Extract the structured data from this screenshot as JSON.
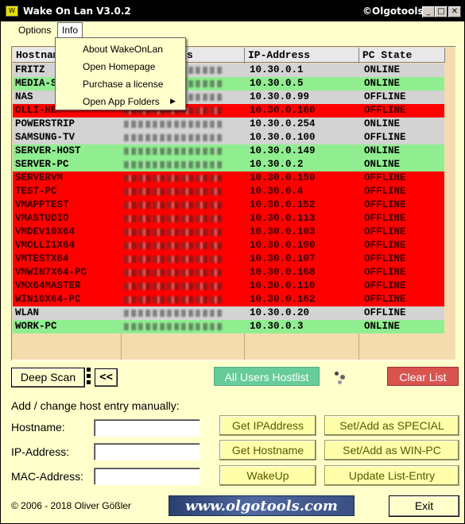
{
  "titlebar": {
    "title": "Wake On Lan V3.0.2",
    "brand": "©Olgotools",
    "minimize": "_",
    "maximize": "□",
    "close": "✕",
    "icon_label": "W"
  },
  "menu": {
    "options": "Options",
    "info": "Info",
    "info_items": [
      "About WakeOnLan",
      "Open Homepage",
      "Purchase a license",
      "Open App Folders"
    ]
  },
  "table": {
    "headers": [
      "Hostname",
      "MAC-Address",
      "IP-Address",
      "PC State"
    ],
    "rows": [
      {
        "host": "FRITZ",
        "ip": "10.30.0.1",
        "state": "ONLINE",
        "color": "gray"
      },
      {
        "host": "MEDIA-SERVER",
        "ip": "10.30.0.5",
        "state": "ONLINE",
        "color": "green"
      },
      {
        "host": "NAS",
        "ip": "10.30.0.99",
        "state": "OFFLINE",
        "color": "gray"
      },
      {
        "host": "OLLI-HB",
        "ip": "10.30.0.160",
        "state": "OFFLINE",
        "color": "red"
      },
      {
        "host": "POWERSTRIP",
        "ip": "10.30.0.254",
        "state": "ONLINE",
        "color": "gray"
      },
      {
        "host": "SAMSUNG-TV",
        "ip": "10.30.0.100",
        "state": "OFFLINE",
        "color": "gray"
      },
      {
        "host": "SERVER-HOST",
        "ip": "10.30.0.149",
        "state": "ONLINE",
        "color": "green"
      },
      {
        "host": "SERVER-PC",
        "ip": "10.30.0.2",
        "state": "ONLINE",
        "color": "green"
      },
      {
        "host": "SERVERVM",
        "ip": "10.30.0.150",
        "state": "OFFLINE",
        "color": "red"
      },
      {
        "host": "TEST-PC",
        "ip": "10.30.0.4",
        "state": "OFFLINE",
        "color": "red"
      },
      {
        "host": "VMAPPTEST",
        "ip": "10.30.0.152",
        "state": "OFFLINE",
        "color": "red"
      },
      {
        "host": "VMASTUDIO",
        "ip": "10.30.0.113",
        "state": "OFFLINE",
        "color": "red"
      },
      {
        "host": "VMDEV10X64",
        "ip": "10.30.0.103",
        "state": "OFFLINE",
        "color": "red"
      },
      {
        "host": "VMOLLI1X64",
        "ip": "10.30.0.190",
        "state": "OFFLINE",
        "color": "red"
      },
      {
        "host": "VMTESTX64",
        "ip": "10.30.0.107",
        "state": "OFFLINE",
        "color": "red"
      },
      {
        "host": "VMWIN7X64-PC",
        "ip": "10.30.0.168",
        "state": "OFFLINE",
        "color": "red"
      },
      {
        "host": "VMX64MASTER",
        "ip": "10.30.0.110",
        "state": "OFFLINE",
        "color": "red"
      },
      {
        "host": "WIN10X64-PC",
        "ip": "10.30.0.162",
        "state": "OFFLINE",
        "color": "red"
      },
      {
        "host": "WLAN",
        "ip": "10.30.0.20",
        "state": "OFFLINE",
        "color": "gray"
      },
      {
        "host": "WORK-PC",
        "ip": "10.30.0.3",
        "state": "ONLINE",
        "color": "green"
      }
    ]
  },
  "toolbar": {
    "deep_scan": "Deep Scan",
    "collapse": "<<",
    "all_users": "All Users Hostlist",
    "clear_list": "Clear List"
  },
  "form": {
    "section_title": "Add / change host entry manually:",
    "hostname_label": "Hostname:",
    "ip_label": "IP-Address:",
    "mac_label": "MAC-Address:",
    "hostname_value": "",
    "ip_value": "",
    "mac_value": "",
    "get_ip": "Get IPAddress",
    "get_hostname": "Get Hostname",
    "wakeup": "WakeUp",
    "set_special": "Set/Add as SPECIAL",
    "set_winpc": "Set/Add as WIN-PC",
    "update_entry": "Update List-Entry"
  },
  "footer": {
    "copyright": "© 2006 - 2018  Oliver Gößler",
    "banner": "www.olgotools.com",
    "exit": "Exit"
  },
  "colors": {
    "online_green": "#90ee90",
    "offline_red": "#ff0000",
    "neutral_gray": "#d3d3d3",
    "window_bg": "#ffffcc",
    "all_users_btn": "#66cc99",
    "clear_list_btn": "#d9534f"
  }
}
